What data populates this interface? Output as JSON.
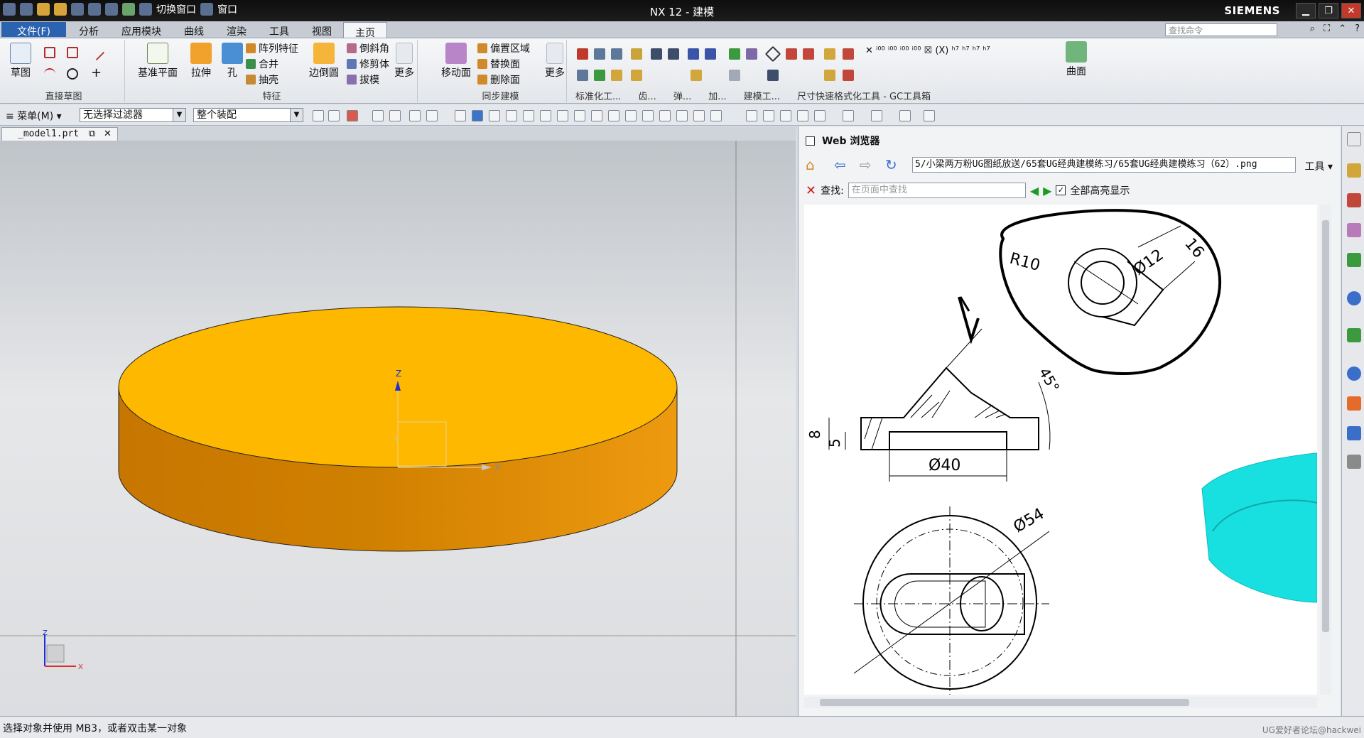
{
  "window": {
    "title": "NX 12 - 建模",
    "brand": "SIEMENS",
    "quick_access": {
      "switch_window": "切换窗口",
      "window": "窗口"
    }
  },
  "menubar": {
    "file": "文件(F)",
    "tabs": [
      "分析",
      "应用模块",
      "曲线",
      "渲染",
      "工具",
      "视图",
      "主页"
    ],
    "active_tab": "主页",
    "search_placeholder": "查找命令"
  },
  "ribbon": {
    "direct_sketch": {
      "label": "直接草图",
      "sketch": "草图"
    },
    "feature": {
      "label": "特征",
      "datum_plane": "基准平面",
      "extrude": "拉伸",
      "hole": "孔",
      "pattern": "阵列特征",
      "unite": "合并",
      "shell": "抽壳",
      "edge_blend": "边倒圆",
      "chamfer": "倒斜角",
      "trim_body": "修剪体",
      "draft": "拔模",
      "more": "更多"
    },
    "sync": {
      "label": "同步建模",
      "move_face": "移动面",
      "offset_region": "偏置区域",
      "replace_face": "替换面",
      "delete_face": "删除面",
      "more": "更多"
    },
    "lower_labels": [
      "标准化工...",
      "齿...",
      "弹...",
      "加...",
      "建模工...",
      "尺寸快速格式化工具 - GC工具箱"
    ],
    "surface": "曲面"
  },
  "toolbar2": {
    "menu": "菜单(M)",
    "filter": "无选择过滤器",
    "assembly": "整个装配"
  },
  "document": {
    "tab": "_model1.prt"
  },
  "viewport": {
    "body_top_color": "#ffb800",
    "body_side_color": "#e08a00",
    "axis_z": "Z",
    "axis_x": "X",
    "axis_y": "Y"
  },
  "browser": {
    "title": "Web 浏览器",
    "url": "5/小梁两万粉UG图纸放送/65套UG经典建模练习/65套UG经典建模练习（62）.png",
    "tools": "工具",
    "find_label": "查找:",
    "find_placeholder": "在页面中查找",
    "highlight_all": "全部高亮显示",
    "drawing": {
      "r10": "R10",
      "d12": "Ø12",
      "d16": "16",
      "angle": "45°",
      "d8": "8",
      "d5": "5",
      "d40": "Ø40",
      "d54": "Ø54"
    }
  },
  "status": {
    "message": "选择对象并使用 MB3，或者双击某一对象",
    "watermark": "UG爱好者论坛@hackwei"
  }
}
